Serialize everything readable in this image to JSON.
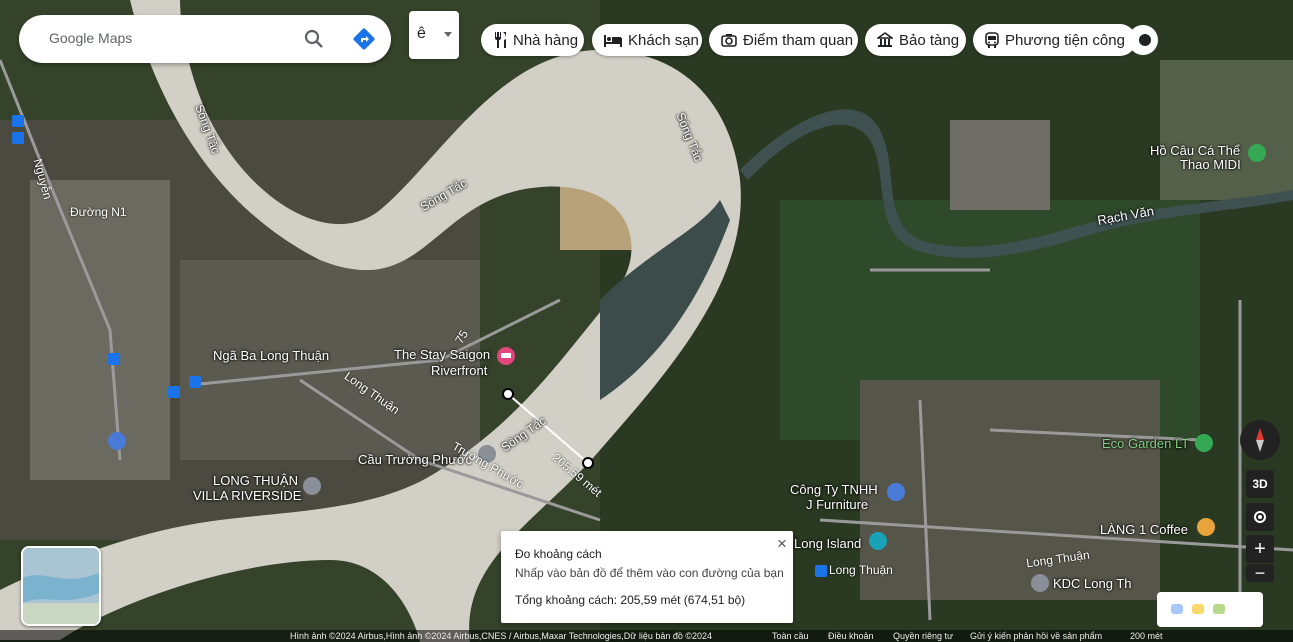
{
  "search": {
    "text": "Google Maps"
  },
  "lang_button": {
    "label": "ê"
  },
  "categories": [
    {
      "label": "Nhà hàng",
      "icon": "restaurant-icon"
    },
    {
      "label": "Khách sạn",
      "icon": "hotel-icon"
    },
    {
      "label": "Điểm tham quan",
      "icon": "camera-icon"
    },
    {
      "label": "Bảo tàng",
      "icon": "museum-icon"
    },
    {
      "label": "Phương tiện công c",
      "icon": "transit-icon"
    }
  ],
  "places": {
    "song_tac_1": "Sông Tắc",
    "song_tac_2": "Sông Tắc",
    "song_tac_3": "Sông Tắc",
    "song_tac_4": "Sông Tắc",
    "rach_van": "Rạch Văn",
    "ho_cau": "Hồ Câu Cá Thể",
    "ho_cau_2": "Thao MIDI",
    "duong_n1": "Đường N1",
    "nga_ba": "Ngã Ba Long Thuận",
    "the_stay": "The Stay Saigon",
    "the_stay_2": "Riverfront",
    "cau_truong_phuoc": "Cầu Trường Phước",
    "long_thuan_villa": "LONG THUẬN",
    "long_thuan_villa_2": "VILLA RIVERSIDE",
    "cong_ty": "Công Ty TNHH",
    "cong_ty_2": "J Furniture",
    "eco_garden": "Eco Garden LT",
    "lang1": "LÀNG 1 Coffee",
    "long_island": "Long Island",
    "long_thuan_road": "Long Thuận",
    "long_thuan_road2": "Long Thuận",
    "kdc": "KDC Long Th",
    "distance_label": "205,59 mét",
    "road_75": "75",
    "road_tp": "Trường Phước",
    "road_lt": "Long Thuận",
    "road_nguyen": "Nguyễn"
  },
  "measure": {
    "title": "Đo khoảng cách",
    "hint": "Nhấp vào bản đồ để thêm vào con đường của bạn",
    "total": "Tổng khoảng cách: 205,59 mét (674,51 bộ)",
    "close": "×"
  },
  "controls": {
    "three_d": "3D",
    "zoom_in": "+",
    "zoom_out": "−"
  },
  "footer": {
    "imagery": "Hình ảnh ©2024 Airbus,Hình ảnh ©2024 Airbus,CNES / Airbus,Maxar Technologies,Dữ liệu bản đồ ©2024",
    "terms": "Toàn cầu",
    "terms2": "Điều khoản",
    "privacy": "Quyền riêng tư",
    "feedback": "Gửi ý kiến phản hồi về sản phẩm",
    "scale": "200 mét"
  },
  "colors": {
    "river": "#d9d6cf",
    "vegetation": "#2f3d23",
    "water_dark": "#3a4a4a"
  }
}
